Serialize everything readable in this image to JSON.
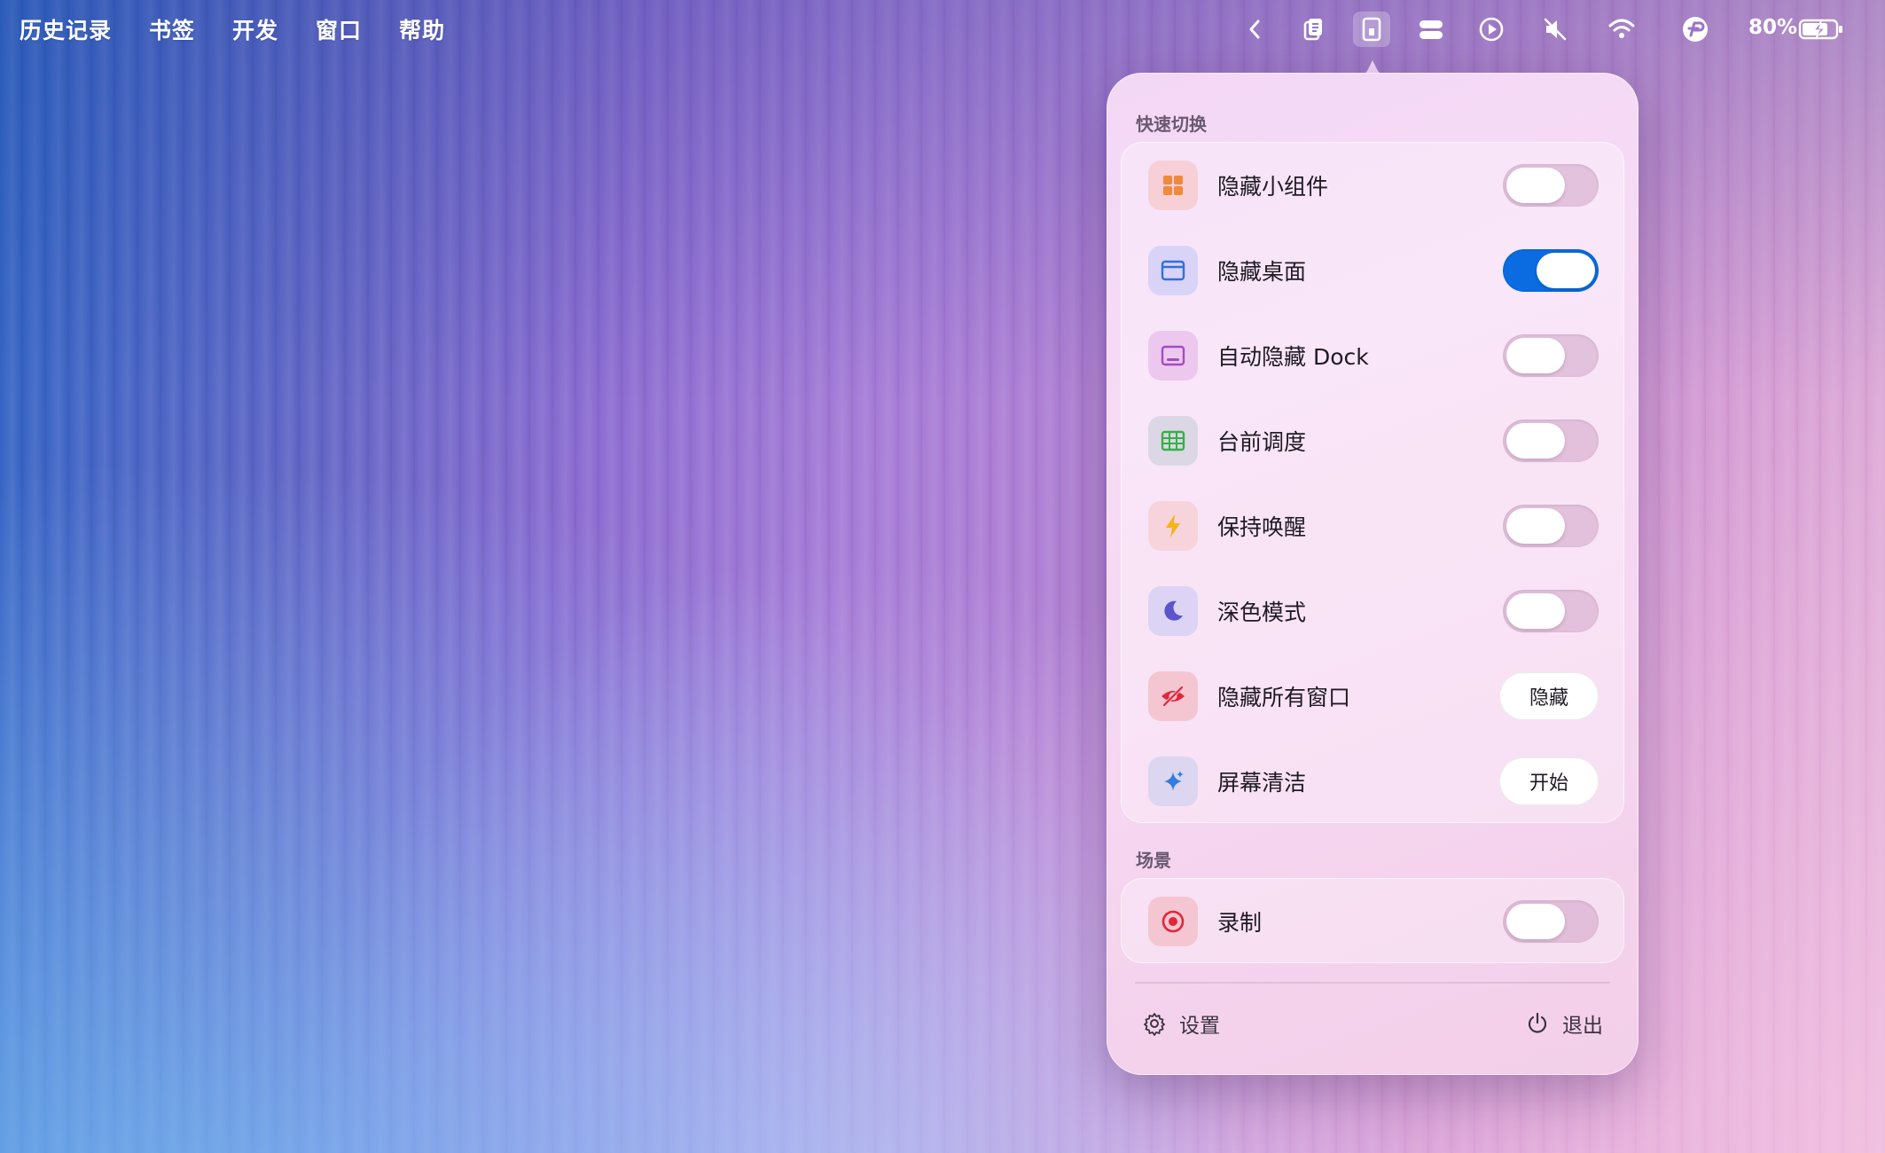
{
  "menubar": {
    "items": [
      "历史记录",
      "书签",
      "开发",
      "窗口",
      "帮助"
    ],
    "battery_percent": "80%"
  },
  "menubar_icons": [
    {
      "name": "chevron-left-icon"
    },
    {
      "name": "clipboard-icon"
    },
    {
      "name": "app-menu-icon"
    },
    {
      "name": "control-center-icon"
    },
    {
      "name": "play-icon"
    },
    {
      "name": "mute-icon"
    },
    {
      "name": "wifi-icon"
    },
    {
      "name": "app-status-icon"
    },
    {
      "name": "battery-charging-icon"
    }
  ],
  "popover": {
    "quick_toggle_title": "快速切换",
    "quick_toggles": [
      {
        "label": "隐藏小组件",
        "icon": "widgets-icon",
        "icon_color": "#f08a3a",
        "icon_bg": "#f7cfd6",
        "control": "toggle",
        "on": false
      },
      {
        "label": "隐藏桌面",
        "icon": "desktop-window-icon",
        "icon_color": "#2f6fe0",
        "icon_bg": "#d9d3f7",
        "control": "toggle",
        "on": true
      },
      {
        "label": "自动隐藏 Dock",
        "icon": "dock-icon",
        "icon_color": "#a24cc2",
        "icon_bg": "#ecc8ee",
        "control": "toggle",
        "on": false
      },
      {
        "label": "台前调度",
        "icon": "stage-manager-icon",
        "icon_color": "#35b04a",
        "icon_bg": "#dcd7e4",
        "control": "toggle",
        "on": false
      },
      {
        "label": "保持唤醒",
        "icon": "bolt-icon",
        "icon_color": "#f6b21b",
        "icon_bg": "#f7d4dc",
        "control": "toggle",
        "on": false
      },
      {
        "label": "深色模式",
        "icon": "moon-icon",
        "icon_color": "#5b55c9",
        "icon_bg": "#dcd3f5",
        "control": "toggle",
        "on": false
      },
      {
        "label": "隐藏所有窗口",
        "icon": "eye-slash-icon",
        "icon_color": "#e2263a",
        "icon_bg": "#f4c6d2",
        "control": "button",
        "button_label": "隐藏"
      },
      {
        "label": "屏幕清洁",
        "icon": "sparkle-icon",
        "icon_color": "#2f7ee0",
        "icon_bg": "#dcd6f1",
        "control": "button",
        "button_label": "开始"
      }
    ],
    "scenes_title": "场景",
    "scenes": [
      {
        "label": "录制",
        "icon": "record-icon",
        "icon_color": "#e2263a",
        "icon_bg": "#f4c6d2",
        "control": "toggle",
        "on": false
      }
    ],
    "footer": {
      "settings_label": "设置",
      "quit_label": "退出"
    }
  },
  "colors": {
    "toggle_on": "#0a6ce0",
    "toggle_off": "#d8a8cc"
  }
}
